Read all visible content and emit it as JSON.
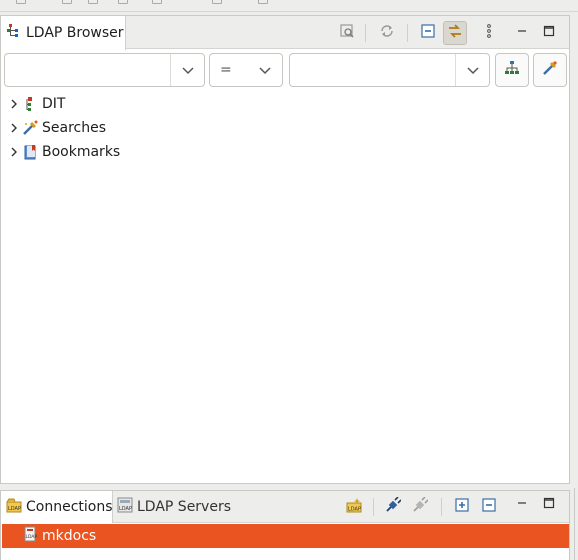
{
  "browser": {
    "tab_label": "LDAP Browser",
    "quick_search": {
      "attribute_value": "",
      "operator_value": "=",
      "value_value": ""
    },
    "tree": [
      {
        "label": "DIT",
        "icon": "dit-icon"
      },
      {
        "label": "Searches",
        "icon": "searches-icon"
      },
      {
        "label": "Bookmarks",
        "icon": "bookmarks-icon"
      }
    ]
  },
  "connections": {
    "tab_label": "Connections",
    "servers_tab_label": "LDAP Servers",
    "items": [
      {
        "label": "mkdocs",
        "selected": true
      }
    ]
  },
  "colors": {
    "selection": "#e95420",
    "background": "#ededeb"
  }
}
